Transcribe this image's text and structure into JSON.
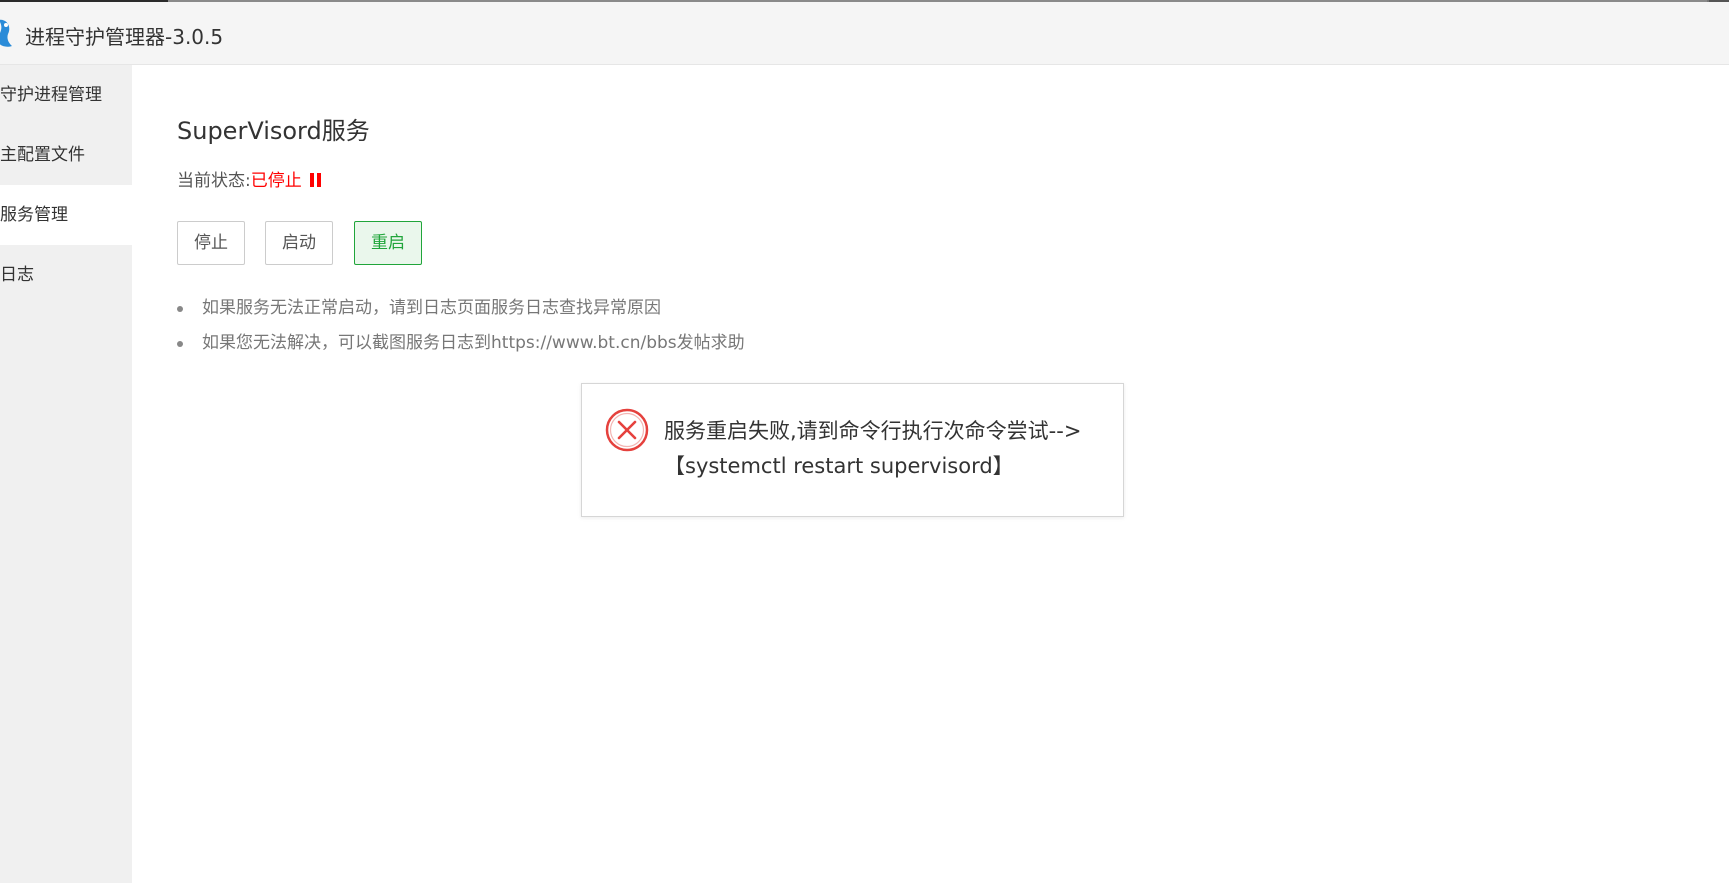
{
  "window": {
    "title": "进程守护管理器-3.0.5"
  },
  "sidebar": {
    "items": [
      {
        "label": "守护进程管理"
      },
      {
        "label": "主配置文件"
      },
      {
        "label": "服务管理"
      },
      {
        "label": "日志"
      }
    ],
    "active_index": 2
  },
  "service": {
    "title": "SuperVisord服务",
    "status_label": "当前状态:",
    "status_value": "已停止",
    "status_color": "#ff0000",
    "buttons": {
      "stop": "停止",
      "start": "启动",
      "restart": "重启"
    },
    "tips": [
      "如果服务无法正常启动，请到日志页面服务日志查找异常原因",
      "如果您无法解决，可以截图服务日志到https://www.bt.cn/bbs发帖求助"
    ]
  },
  "error_dialog": {
    "icon": "error-x-icon",
    "line1": "服务重启失败,请到命令行执行次命令尝试-->",
    "line2": "【systemctl restart supervisord】"
  },
  "colors": {
    "accent_green": "#20a53a",
    "error_red": "#e5413d",
    "status_red": "#ff0000"
  }
}
